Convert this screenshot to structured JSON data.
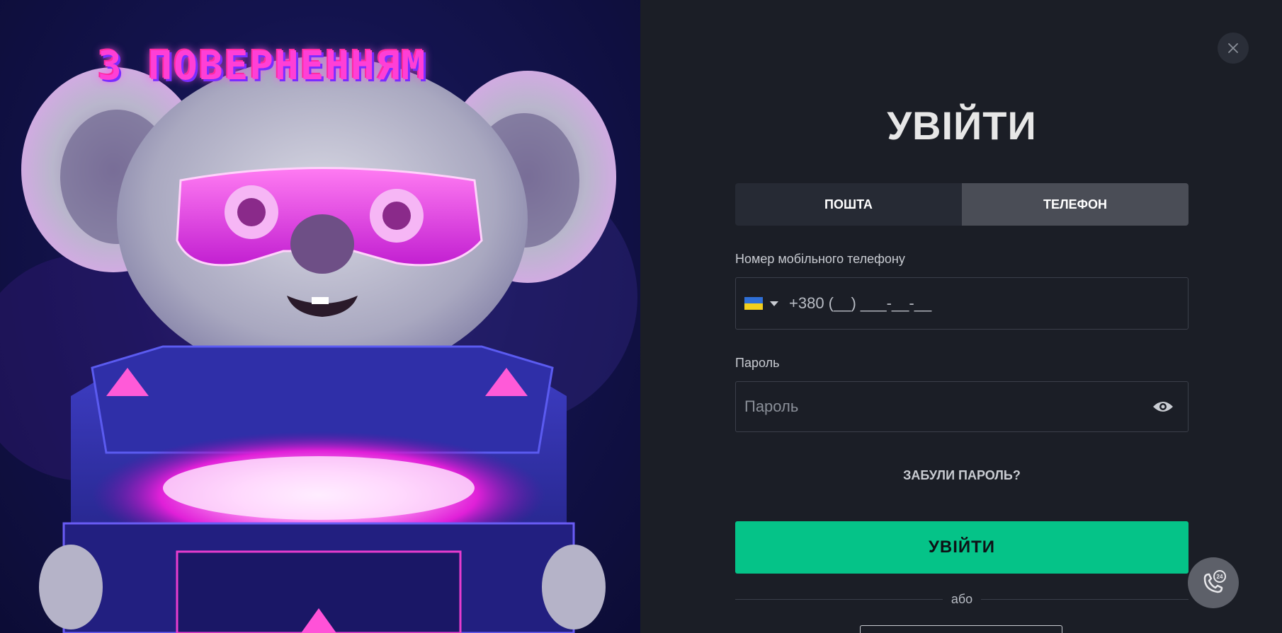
{
  "promo": {
    "title": "З ПОВЕРНЕННЯМ"
  },
  "login": {
    "heading": "УВІЙТИ",
    "tabs": [
      {
        "label": "ПОШТА",
        "active": false
      },
      {
        "label": "ТЕЛЕФОН",
        "active": true
      }
    ],
    "phone_label": "Номер мобільного телефону",
    "phone_value": "+380 (__) ___-__-__",
    "country_icon": "ukraine-flag-icon",
    "password_label": "Пароль",
    "password_placeholder": "Пароль",
    "forgot_label": "ЗАБУЛИ ПАРОЛЬ?",
    "submit_label": "УВІЙТИ",
    "or_label": "або"
  },
  "colors": {
    "accent": "#05c388",
    "panel_bg": "#1b1e26",
    "tab_active": "#4a4d56",
    "tab_inactive": "#262a34"
  },
  "icons": [
    "close-icon",
    "eye-icon",
    "support-24-icon",
    "chevron-down-icon"
  ]
}
